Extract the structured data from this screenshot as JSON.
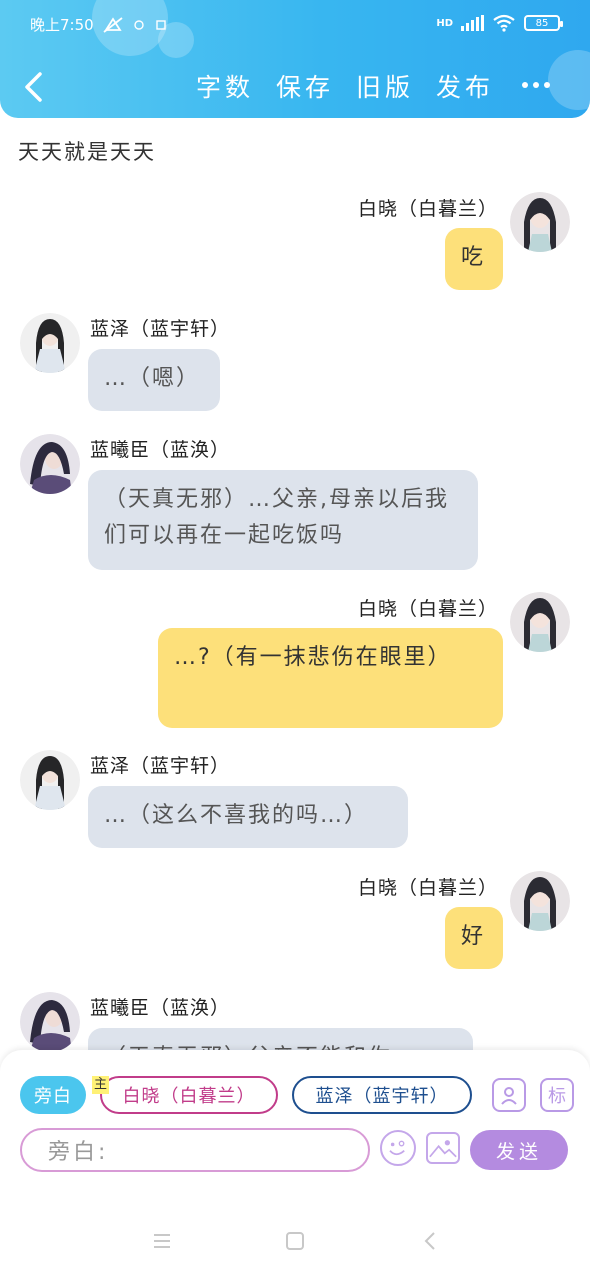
{
  "status": {
    "time": "晚上7:50",
    "battery": "85",
    "network": "HD"
  },
  "header": {
    "actions": [
      "字数",
      "保存",
      "旧版",
      "发布"
    ]
  },
  "chat_title": "天天就是天天",
  "messages": [
    {
      "side": "right",
      "name": "白晓（白暮兰）",
      "text": "吃"
    },
    {
      "side": "left",
      "name": "蓝泽（蓝宇轩）",
      "text": "…（嗯）"
    },
    {
      "side": "left",
      "name": "蓝曦臣（蓝涣）",
      "text": "（天真无邪）…父亲,母亲以后我们可以再在一起吃饭吗"
    },
    {
      "side": "right",
      "name": "白晓（白暮兰）",
      "text": "…?（有一抹悲伤在眼里）"
    },
    {
      "side": "left",
      "name": "蓝泽（蓝宇轩）",
      "text": "…（这么不喜我的吗…）"
    },
    {
      "side": "right",
      "name": "白晓（白暮兰）",
      "text": "好"
    },
    {
      "side": "left",
      "name": "蓝曦臣（蓝涣）",
      "text": "（天真无邪）父亲不能和你"
    }
  ],
  "composer": {
    "role_narration": "旁白",
    "main_tag": "主",
    "role_baixiao": "白晓（白暮兰）",
    "role_lanze": "蓝泽（蓝宇轩）",
    "tag_button": "标",
    "input_placeholder": "旁白:",
    "send_label": "发送"
  },
  "colors": {
    "header_gradient_start": "#5ccaf2",
    "header_gradient_end": "#2fa8ef",
    "bubble_left": "#dde3ec",
    "bubble_right": "#fde07a",
    "send_button": "#b48be0",
    "narration_chip": "#4bc6ee",
    "baixiao_border": "#c13c8a",
    "lanze_border": "#1e4f8f"
  }
}
